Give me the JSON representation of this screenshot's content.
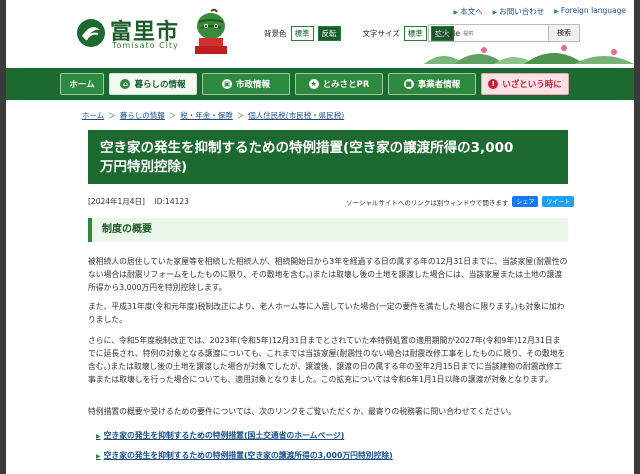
{
  "header": {
    "city_name": "富里市",
    "city_sub": "Tomisato City",
    "top_links": [
      "本文へ",
      "お問い合わせ",
      "Foreign language"
    ],
    "bg_label": "背景色",
    "bg_options": [
      "標準",
      "反転"
    ],
    "font_label": "文字サイズ",
    "font_options": [
      "標準",
      "拡大"
    ],
    "search": {
      "brand": "Google",
      "brand_sub": "提供",
      "button": "検索"
    }
  },
  "nav": {
    "items": [
      {
        "label": "ホーム"
      },
      {
        "label": "暮らしの情報"
      },
      {
        "label": "市政情報"
      },
      {
        "label": "とみさとPR"
      },
      {
        "label": "事業者情報"
      },
      {
        "label": "いざという時に"
      }
    ]
  },
  "breadcrumb": [
    "ホーム",
    "暮らしの情報",
    "税・年金・保険",
    "個人住民税(市民税・県民税)"
  ],
  "page": {
    "title_line1": "空き家の発生を抑制するための特例措置(空き家の譲渡所得の3,000",
    "title_line2": "万円特別控除)",
    "date": "[2024年1月4日]",
    "id": "ID:14123",
    "social_note": "ソーシャルサイトへのリンクは別ウィンドウで開きます",
    "share_fb": "シェア",
    "share_tw": "ツイート",
    "section_title": "制度の概要",
    "para1": "被相続人の居住していた家屋等を相続した相続人が、相続開始日から3年を経過する日の属する年の12月31日までに、当該家屋(耐震性のない場合は耐震リフォームをしたものに限り、その敷地を含む。)または取壊し後の土地を譲渡した場合には、当該家屋または土地の譲渡所得から3,000万円を特別控除します。",
    "para2": "また、平成31年度(令和元年度)税制改正により、老人ホーム等に入居していた場合(一定の要件を満たした場合に限ります。)も対象に加わりました。",
    "para3": "さらに、令和5年度税制改正では、2023年(令和5年)12月31日までとされていた本特例処置の適用期間が2027年(令和9年)12月31日までに延長され、特例の対象となる譲渡についても、これまでは当該家屋(耐震性のない場合は耐震改修工事をしたものに限り、その敷地を含む。)または取壊し後の土地を譲渡した場合が対象でしたが、譲渡後、譲渡の日の属する年の翌年2月15日までに当該建物の耐震改修工事または取壊しを行った場合についても、適用対象となりました。この拡充については令和6年1月1日以降の譲渡が対象となります。",
    "para4": "特例措置の概要や受けるための要件については、次のリンクをご覧いただくか、最寄りの税務署に問い合わせてください。",
    "links": [
      "空き家の発生を抑制するための特例措置(国土交通省のホームページ)",
      "空き家の発生を抑制するための特例措置(空き家の譲渡所得の3,000万円特別控除)"
    ]
  },
  "colors": {
    "brand_green": "#1d6a31",
    "link_blue": "#1a4f8a",
    "emergency_pink": "#fde0e6"
  }
}
